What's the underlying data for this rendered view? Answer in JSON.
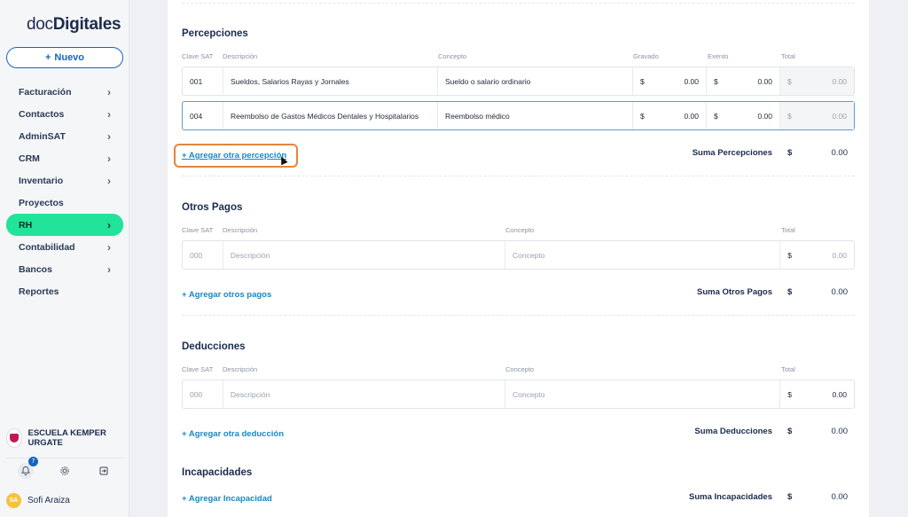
{
  "sidebar": {
    "logo_prefix": "doc",
    "logo_bold": "Digitales",
    "new_button": "Nuevo",
    "items": [
      {
        "label": "Facturación",
        "chevron": true
      },
      {
        "label": "Contactos",
        "chevron": true
      },
      {
        "label": "AdminSAT",
        "chevron": true
      },
      {
        "label": "CRM",
        "chevron": true
      },
      {
        "label": "Inventario",
        "chevron": true
      },
      {
        "label": "Proyectos",
        "chevron": false
      },
      {
        "label": "RH",
        "chevron": true,
        "active": true
      },
      {
        "label": "Contabilidad",
        "chevron": true
      },
      {
        "label": "Bancos",
        "chevron": true
      },
      {
        "label": "Reportes",
        "chevron": false
      }
    ],
    "company_name": "ESCUELA KEMPER URGATE",
    "notifications_count": "7",
    "user_initials": "SA",
    "user_name": "Sofi Araiza"
  },
  "percepciones": {
    "title": "Percepciones",
    "headers": {
      "clave": "Clave SAT",
      "descripcion": "Descripción",
      "concepto": "Concepto",
      "gravado": "Gravado",
      "exento": "Exento",
      "total": "Total"
    },
    "rows": [
      {
        "clave": "001",
        "descripcion": "Sueldos, Salarios Rayas y Jornales",
        "concepto": "Sueldo o salario ordinario",
        "gravado_cur": "$",
        "gravado": "0.00",
        "exento_cur": "$",
        "exento": "0.00",
        "total_cur": "$",
        "total": "0.00"
      },
      {
        "clave": "004",
        "descripcion": "Reembolso de Gastos Médicos Dentales y Hospitalarios",
        "concepto": "Reembolso médico",
        "gravado_cur": "$",
        "gravado": "0.00",
        "exento_cur": "$",
        "exento": "0.00",
        "total_cur": "$",
        "total": "0.00"
      }
    ],
    "add_link": "+ Agregar otra percepción",
    "sum_label": "Suma Percepciones",
    "sum_cur": "$",
    "sum_value": "0.00"
  },
  "otros_pagos": {
    "title": "Otros Pagos",
    "headers": {
      "clave": "Clave SAT",
      "descripcion": "Descripción",
      "concepto": "Concepto",
      "total": "Total"
    },
    "row": {
      "clave": "000",
      "descripcion": "Descripción",
      "concepto": "Concepto",
      "total_cur": "$",
      "total": "0.00"
    },
    "add_link": "+ Agregar otros pagos",
    "sum_label": "Suma Otros Pagos",
    "sum_cur": "$",
    "sum_value": "0.00"
  },
  "deducciones": {
    "title": "Deducciones",
    "headers": {
      "clave": "Clave SAT",
      "descripcion": "Descripción",
      "concepto": "Concepto",
      "total": "Total"
    },
    "row": {
      "clave": "000",
      "descripcion": "Descripción",
      "concepto": "Concepto",
      "total_cur": "$",
      "total": "0.00"
    },
    "add_link": "+ Agregar otra deducción",
    "sum_label": "Suma Deducciones",
    "sum_cur": "$",
    "sum_value": "0.00"
  },
  "incapacidades": {
    "title": "Incapacidades",
    "add_link": "+ Agregar Incapacidad",
    "sum_label": "Suma Incapacidades",
    "sum_cur": "$",
    "sum_value": "0.00"
  },
  "colors": {
    "accent": "#1565c0",
    "active_nav": "#22e39a",
    "link": "#1a86c4",
    "highlight": "#e5853d"
  }
}
